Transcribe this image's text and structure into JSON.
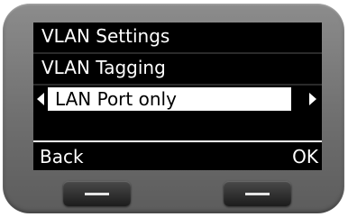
{
  "screen": {
    "title": "VLAN Settings",
    "field_label": "VLAN Tagging",
    "selected_value": "LAN Port only",
    "softkey_left": "Back",
    "softkey_right": "OK"
  },
  "icons": {
    "left": "chevron-left-icon",
    "right": "chevron-right-icon"
  },
  "colors": {
    "screen_background": "#000000",
    "screen_text": "#ffffff",
    "highlight_background": "#ffffff",
    "highlight_text": "#000000",
    "device_body": "#7a7a7a",
    "hardware_key": "#2a2a2a"
  }
}
